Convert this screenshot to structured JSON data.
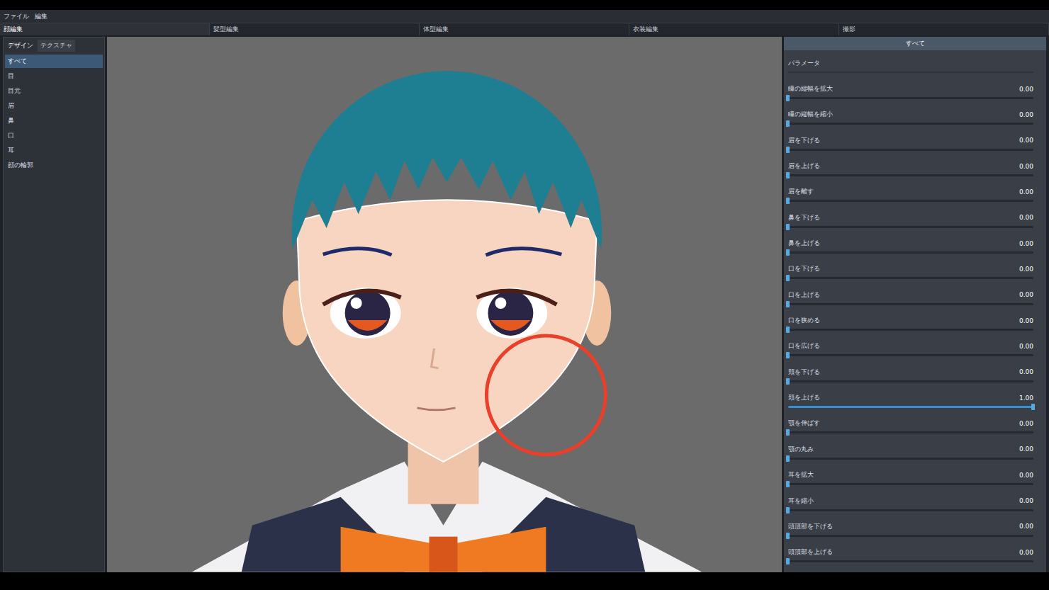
{
  "menu": [
    "ファイル",
    "編集"
  ],
  "tabs": [
    {
      "label": "顔編集",
      "selected": true
    },
    {
      "label": "髪型編集",
      "selected": false
    },
    {
      "label": "体型編集",
      "selected": false
    },
    {
      "label": "衣装編集",
      "selected": false
    },
    {
      "label": "撮影",
      "selected": false
    }
  ],
  "sidebar": {
    "tabs": [
      {
        "label": "デザイン",
        "selected": true
      },
      {
        "label": "テクスチャ",
        "selected": false
      }
    ],
    "items": [
      {
        "label": "すべて",
        "selected": true
      },
      {
        "label": "目",
        "selected": false
      },
      {
        "label": "目元",
        "selected": false
      },
      {
        "label": "眉",
        "selected": false
      },
      {
        "label": "鼻",
        "selected": false
      },
      {
        "label": "口",
        "selected": false
      },
      {
        "label": "耳",
        "selected": false
      },
      {
        "label": "顔の輪郭",
        "selected": false
      }
    ]
  },
  "panel": {
    "title": "すべて",
    "parameters": [
      {
        "label": "パラメータ",
        "kind": "heading"
      },
      {
        "label": "瞳の縦幅を拡大",
        "kind": "slider",
        "value": "0.00",
        "level": 0
      },
      {
        "label": "瞳の縦幅を縮小",
        "kind": "slider",
        "value": "0.00",
        "level": 0
      },
      {
        "label": "眉を下げる",
        "kind": "slider",
        "value": "0.00",
        "level": 0
      },
      {
        "label": "眉を上げる",
        "kind": "slider",
        "value": "0.00",
        "level": 0
      },
      {
        "label": "眉を離す",
        "kind": "slider",
        "value": "0.00",
        "level": 0
      },
      {
        "label": "鼻を下げる",
        "kind": "slider",
        "value": "0.00",
        "level": 0
      },
      {
        "label": "鼻を上げる",
        "kind": "slider",
        "value": "0.00",
        "level": 0
      },
      {
        "label": "口を下げる",
        "kind": "slider",
        "value": "0.00",
        "level": 0
      },
      {
        "label": "口を上げる",
        "kind": "slider",
        "value": "0.00",
        "level": 0
      },
      {
        "label": "口を狭める",
        "kind": "slider",
        "value": "0.00",
        "level": 0
      },
      {
        "label": "口を広げる",
        "kind": "slider",
        "value": "0.00",
        "level": 0
      },
      {
        "label": "頬を下げる",
        "kind": "slider",
        "value": "0.00",
        "level": 0
      },
      {
        "label": "頬を上げる",
        "kind": "slider",
        "value": "1.00",
        "level": 1
      },
      {
        "label": "顎を伸ばす",
        "kind": "slider",
        "value": "0.00",
        "level": 0
      },
      {
        "label": "顎の丸み",
        "kind": "slider",
        "value": "0.00",
        "level": 0
      },
      {
        "label": "耳を拡大",
        "kind": "slider",
        "value": "0.00",
        "level": 0
      },
      {
        "label": "耳を縮小",
        "kind": "slider",
        "value": "0.00",
        "level": 0
      },
      {
        "label": "頭頂部を下げる",
        "kind": "slider",
        "value": "0.00",
        "level": 0
      },
      {
        "label": "頭頂部を上げる",
        "kind": "slider",
        "value": "0.00",
        "level": 0
      }
    ]
  }
}
